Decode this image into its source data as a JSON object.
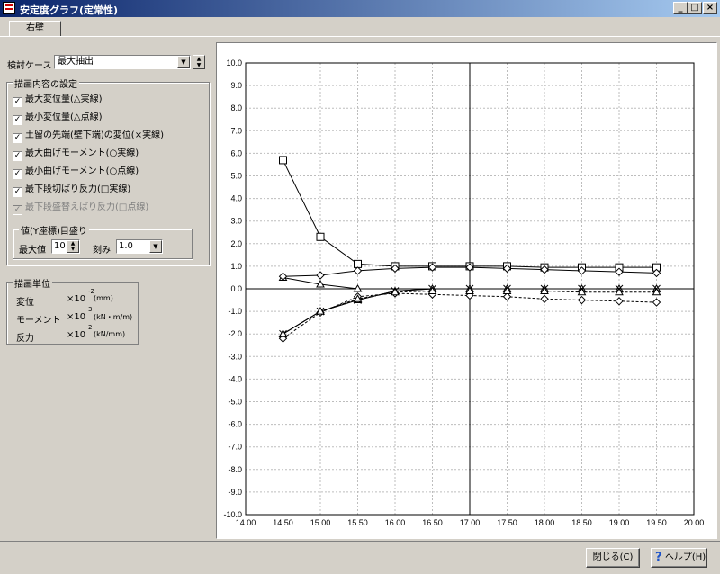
{
  "window": {
    "title": "安定度グラフ(定常性)",
    "controls": [
      "_",
      "□",
      "×"
    ]
  },
  "tab": {
    "label": "右壁"
  },
  "case": {
    "label": "検討ケース",
    "value": "最大抽出"
  },
  "display_group": {
    "title": "描画内容の設定",
    "items": [
      {
        "label": "最大変位量(△実線)",
        "checked": true,
        "disabled": false
      },
      {
        "label": "最小変位量(△点線)",
        "checked": true,
        "disabled": false
      },
      {
        "label": "土留の先端(壁下端)の変位(×実線)",
        "checked": true,
        "disabled": false
      },
      {
        "label": "最大曲げモーメント(○実線)",
        "checked": true,
        "disabled": false
      },
      {
        "label": "最小曲げモーメント(○点線)",
        "checked": true,
        "disabled": false
      },
      {
        "label": "最下段切ばり反力(□実線)",
        "checked": true,
        "disabled": false
      },
      {
        "label": "最下段盛替えばり反力(□点線)",
        "checked": true,
        "disabled": true
      }
    ],
    "scale_group": {
      "title": "値(Y座標)目盛り",
      "max_label": "最大値",
      "max_value": "10",
      "step_label": "刻み",
      "step_value": "1.0"
    }
  },
  "units_group": {
    "title": "描画単位",
    "rows": [
      {
        "name": "変位",
        "base": "×10",
        "exp": "-2",
        "unit": "(mm)"
      },
      {
        "name": "モーメント",
        "base": "×10",
        "exp": "3",
        "unit": "(kN・m/m)"
      },
      {
        "name": "反力",
        "base": "×10",
        "exp": "2",
        "unit": "(kN/mm)"
      }
    ]
  },
  "buttons": {
    "close": "閉じる(C)",
    "help": "ヘルプ(H)"
  },
  "chart_data": {
    "type": "line",
    "xlim": [
      14.0,
      20.0
    ],
    "ylim": [
      -10.0,
      10.0
    ],
    "x_ticks": [
      "14.00",
      "14.50",
      "15.00",
      "15.50",
      "16.00",
      "16.50",
      "17.00",
      "17.50",
      "18.00",
      "18.50",
      "19.00",
      "19.50",
      "20.00"
    ],
    "y_ticks": [
      "10.0",
      "9.0",
      "8.0",
      "7.0",
      "6.0",
      "5.0",
      "4.0",
      "3.0",
      "2.0",
      "1.0",
      "0.0",
      "-1.0",
      "-2.0",
      "-3.0",
      "-4.0",
      "-5.0",
      "-6.0",
      "-7.0",
      "-8.0",
      "-9.0",
      "-10.0"
    ],
    "grid": true,
    "vertical_marker_x": 17.0,
    "series": [
      {
        "marker": "square",
        "dash": false,
        "x": [
          14.5,
          15.0,
          15.5,
          16.0,
          16.5,
          17.0,
          17.5,
          18.0,
          18.5,
          19.0,
          19.5
        ],
        "y": [
          5.7,
          2.3,
          1.1,
          1.0,
          1.0,
          1.0,
          1.0,
          0.95,
          0.95,
          0.95,
          0.95
        ]
      },
      {
        "marker": "triangle",
        "dash": false,
        "x": [
          14.5,
          15.0,
          15.5
        ],
        "y": [
          0.5,
          0.2,
          0.0
        ]
      },
      {
        "marker": "diamond",
        "dash": false,
        "x": [
          14.5,
          15.0,
          15.5,
          16.0,
          16.5,
          17.0,
          17.5,
          18.0,
          18.5,
          19.0,
          19.5
        ],
        "y": [
          0.55,
          0.6,
          0.8,
          0.9,
          0.95,
          0.95,
          0.9,
          0.85,
          0.8,
          0.75,
          0.7
        ]
      },
      {
        "marker": "triangle",
        "dash": false,
        "x": [
          14.5,
          15.0,
          15.5,
          16.0,
          16.5,
          17.0,
          17.5,
          18.0,
          18.5,
          19.0,
          19.5
        ],
        "y": [
          -2.0,
          -1.0,
          -0.5,
          -0.1,
          0.0,
          0.0,
          0.0,
          0.0,
          0.0,
          0.0,
          0.0
        ]
      },
      {
        "marker": "cross",
        "dash": false,
        "x": [
          14.5,
          15.0,
          15.5,
          16.0,
          16.5,
          17.0,
          17.5,
          18.0,
          18.5,
          19.0,
          19.5
        ],
        "y": [
          -2.0,
          -1.0,
          -0.5,
          -0.1,
          0.0,
          0.0,
          0.0,
          0.0,
          0.0,
          0.0,
          0.0
        ]
      },
      {
        "marker": "diamond",
        "dash": true,
        "x": [
          14.5,
          15.0,
          15.5,
          16.0,
          16.5,
          17.0,
          17.5,
          18.0,
          18.5,
          19.0,
          19.5
        ],
        "y": [
          -2.2,
          -1.05,
          -0.35,
          -0.2,
          -0.25,
          -0.3,
          -0.35,
          -0.45,
          -0.5,
          -0.55,
          -0.6
        ]
      },
      {
        "marker": "triangle",
        "dash": true,
        "x": [
          14.5,
          15.0,
          15.5,
          16.0,
          16.5,
          17.0,
          17.5,
          18.0,
          18.5,
          19.0,
          19.5
        ],
        "y": [
          -2.0,
          -1.0,
          -0.45,
          -0.15,
          -0.1,
          -0.1,
          -0.1,
          -0.1,
          -0.15,
          -0.15,
          -0.15
        ]
      }
    ]
  }
}
